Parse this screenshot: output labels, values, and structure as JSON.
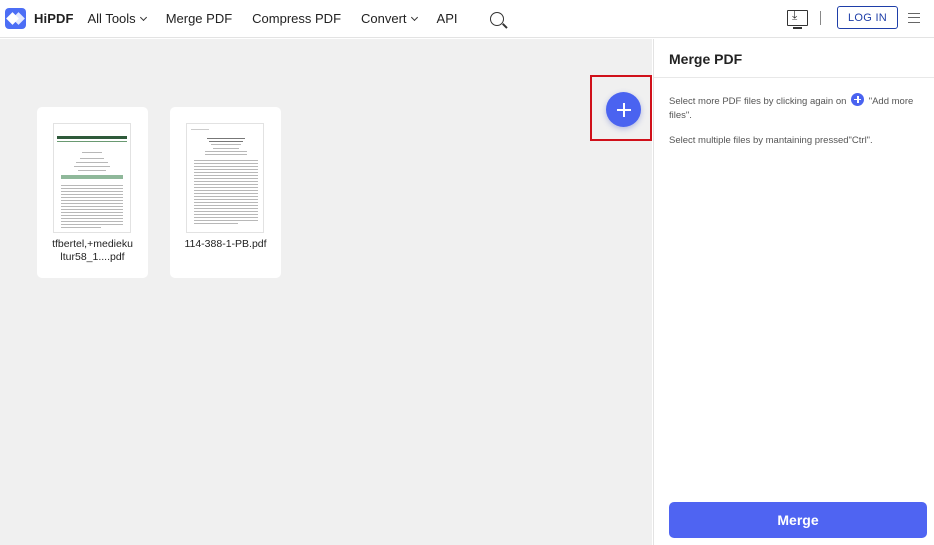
{
  "header": {
    "logo_text": "HiPDF",
    "nav": [
      {
        "label": "All Tools",
        "dropdown": true
      },
      {
        "label": "Merge PDF",
        "dropdown": false
      },
      {
        "label": "Compress PDF",
        "dropdown": false
      },
      {
        "label": "Convert",
        "dropdown": true
      },
      {
        "label": "API",
        "dropdown": false
      }
    ],
    "login_label": "LOG IN",
    "icons": [
      "search-icon",
      "download-icon",
      "menu-icon"
    ]
  },
  "workspace": {
    "files": [
      {
        "name": "tfbertel,+medieku ltur58_1....pdf"
      },
      {
        "name": "114-388-1-PB.pdf"
      }
    ]
  },
  "panel": {
    "title": "Merge PDF",
    "tip1_before": "Select more PDF files by clicking again on",
    "tip1_after": "\"Add more files\".",
    "tip2": "Select multiple files by mantaining pressed\"Ctrl\".",
    "merge_label": "Merge"
  },
  "colors": {
    "accent": "#4a63f0",
    "highlight_frame": "#d0101a",
    "login_border": "#1e3ea8",
    "workspace_bg": "#f0f0f0"
  }
}
